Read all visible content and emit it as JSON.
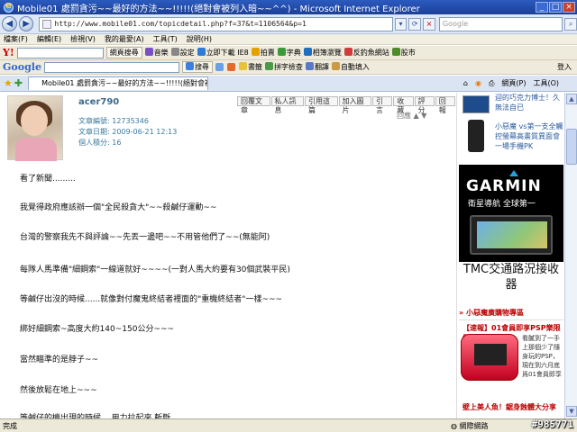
{
  "window": {
    "title": "Mobile01 處罰貪污~~最好的方法~~!!!!!(絕對會被列入暗~~^^) - Microsoft Internet Explorer"
  },
  "address": {
    "url": "http://www.mobile01.com/topicdetail.php?f=37&t=1106564&p=1",
    "search_placeholder": "Google"
  },
  "menu": [
    "檔案(F)",
    "編輯(E)",
    "檢視(V)",
    "我的最愛(A)",
    "工具(T)",
    "說明(H)"
  ],
  "toolbar1": {
    "brand": "Y!",
    "search_btn": "網頁搜尋",
    "items": [
      "音樂",
      "設定",
      "立即下載 IE8",
      "拍賣",
      "字典",
      "相簿瀏覽",
      "反釣魚網站",
      "股市"
    ]
  },
  "toolbar2": {
    "brand": "Google",
    "search_btn": "搜尋",
    "items": [
      "書籤",
      "拼字檢查",
      "翻譯",
      "自動填入"
    ],
    "login": "登入"
  },
  "tabbar": {
    "tab_label": "Mobile01 處罰貪污~~最好的方法~~!!!!!(絕對會被",
    "page_btn": "網頁(P)",
    "tools_btn": "工具(O)"
  },
  "post": {
    "username": "acer790",
    "meta": [
      "文章編號: 12735346",
      "文章日期: 2009-06-21 12:13",
      "個人積分: 16"
    ],
    "actions": [
      "回覆文章",
      "私人訊息",
      "引用這篇",
      "加入圖片",
      "引言",
      "收藏",
      "評分",
      "回報"
    ],
    "page_nav": "回應 ▲ ▼",
    "lines": [
      "看了新聞.........",
      "我覺得政府應該辦一個\"全民殺貪大\"~~殺鹹仔運動~~",
      "台灣的警察我先不與評論~~先丟一邊吧~~不用管他們了~~(無能阿)",
      "每隊人馬準備\"細鋼索\"一線道就好~~~~(一對人馬大約要有30個武裝平民)",
      "等鹹仔出沒的時候......就像對付魔鬼終結者裡面的\"重機終結者\"一樣~~~",
      "綁好細鋼索~高度大約140~150公分~~~",
      "當然瞄準的是脖子~~",
      "然後放鬆在地上~~~",
      "等鹹仔的機出現的時候....用力拉起來 斬斷..."
    ]
  },
  "right": {
    "top_items": [
      "迎的巧克力博士！久無法自已",
      "小惡魔 vs第一支全觸控螢幕高畫質異面會一場手機PK"
    ],
    "garmin": {
      "brand": "GARMIN",
      "sub": "衛星導航 全球第一",
      "tmc": "TMC交通路況接收器"
    },
    "section_title": "» 小惡魔廣購物專區",
    "promo1": "【速報】01會員即享PSP樂限價",
    "promo1_body": "看膩到了一手上那個少了隨身玩的PSP，現在到六月底爲01會員即享",
    "promo2": "壁上美人魚！鋸身蝕體大分享"
  },
  "status": {
    "left": "完成",
    "zone": "網際網路"
  },
  "watermark": "#985771"
}
